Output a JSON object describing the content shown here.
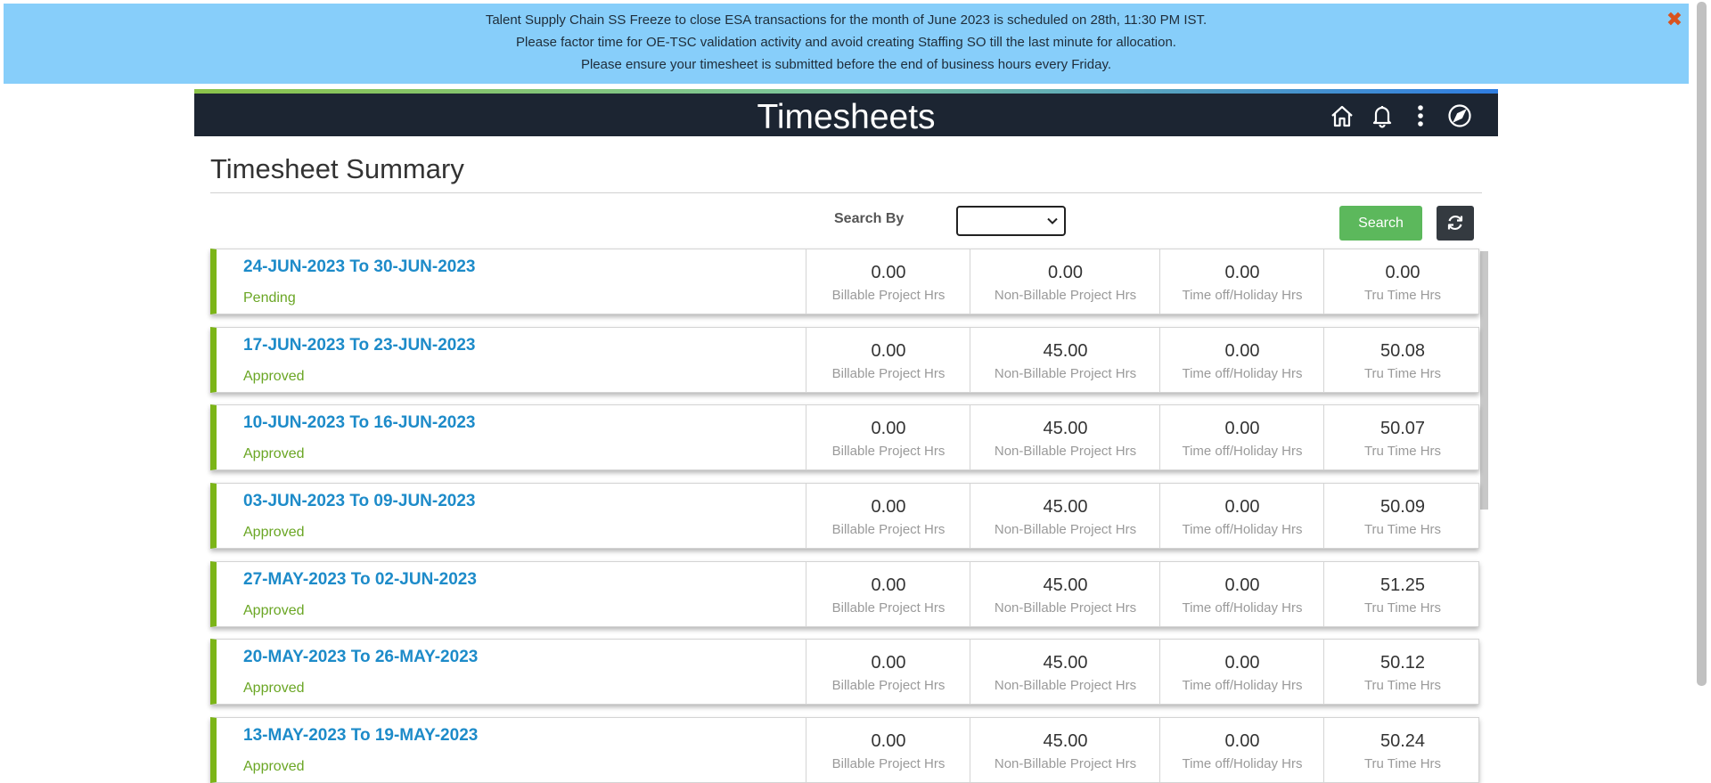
{
  "banner": {
    "lines": [
      "Talent Supply Chain SS Freeze to close ESA transactions for the month of June 2023 is scheduled on 28th, 11:30 PM IST.",
      "Please factor time for OE-TSC validation activity and avoid creating Staffing SO till the last minute for allocation.",
      "Please ensure your timesheet is submitted before the end of business hours every Friday."
    ],
    "close_glyph": "✖"
  },
  "header": {
    "title": "Timesheets",
    "icons": [
      "home-icon",
      "bell-icon",
      "more-vertical-icon",
      "compass-icon"
    ]
  },
  "summary": {
    "title": "Timesheet Summary"
  },
  "search": {
    "label": "Search By",
    "selected_value": "",
    "button_label": "Search",
    "refresh_icon": "refresh-icon"
  },
  "metric_labels": {
    "billable": "Billable Project Hrs",
    "non_billable": "Non-Billable Project Hrs",
    "time_off": "Time off/Holiday Hrs",
    "tru_time": "Tru Time Hrs"
  },
  "timesheets": [
    {
      "range": "24-JUN-2023 To 30-JUN-2023",
      "status": "Pending",
      "billable": "0.00",
      "non_billable": "0.00",
      "time_off": "0.00",
      "tru_time": "0.00"
    },
    {
      "range": "17-JUN-2023 To 23-JUN-2023",
      "status": "Approved",
      "billable": "0.00",
      "non_billable": "45.00",
      "time_off": "0.00",
      "tru_time": "50.08"
    },
    {
      "range": "10-JUN-2023 To 16-JUN-2023",
      "status": "Approved",
      "billable": "0.00",
      "non_billable": "45.00",
      "time_off": "0.00",
      "tru_time": "50.07"
    },
    {
      "range": "03-JUN-2023 To 09-JUN-2023",
      "status": "Approved",
      "billable": "0.00",
      "non_billable": "45.00",
      "time_off": "0.00",
      "tru_time": "50.09"
    },
    {
      "range": "27-MAY-2023 To 02-JUN-2023",
      "status": "Approved",
      "billable": "0.00",
      "non_billable": "45.00",
      "time_off": "0.00",
      "tru_time": "51.25"
    },
    {
      "range": "20-MAY-2023 To 26-MAY-2023",
      "status": "Approved",
      "billable": "0.00",
      "non_billable": "45.00",
      "time_off": "0.00",
      "tru_time": "50.12"
    },
    {
      "range": "13-MAY-2023 To 19-MAY-2023",
      "status": "Approved",
      "billable": "0.00",
      "non_billable": "45.00",
      "time_off": "0.00",
      "tru_time": "50.24"
    }
  ],
  "colors": {
    "banner_bg": "#87cefa",
    "header_bg": "#1c2532",
    "link_blue": "#1d8bc9",
    "status_green": "#6aa624",
    "card_accent": "#7cb518",
    "search_button": "#5cb85c"
  }
}
